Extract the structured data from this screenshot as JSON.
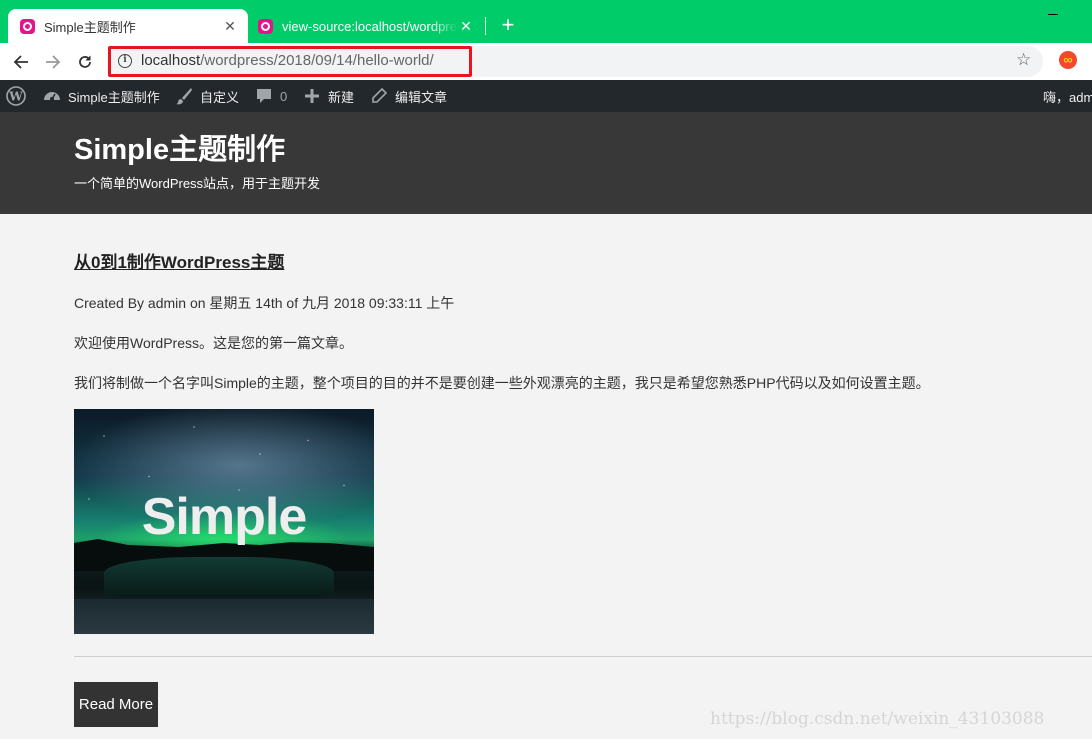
{
  "browser": {
    "tabs": [
      {
        "title": "Simple主题制作",
        "active": true,
        "icon": "wamp-favicon"
      },
      {
        "title": "view-source:localhost/wordpress",
        "active": false,
        "icon": "wamp-favicon"
      }
    ],
    "tab_close_glyph": "✕",
    "new_tab_glyph": "+",
    "toolbar": {
      "back_glyph": "←",
      "forward_glyph": "→",
      "reload_glyph": "↻",
      "info_glyph": "i",
      "url_host": "localhost",
      "url_path": "/wordpress/2018/09/14/hello-world/",
      "bookmark_glyph": "☆",
      "extension_glyph": "∞"
    },
    "accent_color": "#00cc6a",
    "highlight_color": "#e8141e"
  },
  "admin_bar": {
    "items": [
      {
        "name": "wordpress-logo",
        "label": ""
      },
      {
        "name": "site-name",
        "label": "Simple主题制作"
      },
      {
        "name": "customize",
        "label": "自定义"
      },
      {
        "name": "comments",
        "label": "0"
      },
      {
        "name": "new-content",
        "label": "新建"
      },
      {
        "name": "edit-post",
        "label": "编辑文章"
      }
    ],
    "greeting": "嗨，admin"
  },
  "site": {
    "title": "Simple主题制作",
    "description": "一个简单的WordPress站点，用于主题开发"
  },
  "post": {
    "title": "从0到1制作WordPress主题",
    "meta": "Created By admin on 星期五 14th of 九月 2018 09:33:11 上午",
    "paragraphs": [
      "欢迎使用WordPress。这是您的第一篇文章。",
      "我们将制做一个名字叫Simple的主题，整个项目的目的并不是要创建一些外观漂亮的主题，我只是希望您熟悉PHP代码以及如何设置主题。"
    ],
    "image_text": "Simple",
    "read_more": "Read More"
  },
  "watermark": "https://blog.csdn.net/weixin_43103088"
}
